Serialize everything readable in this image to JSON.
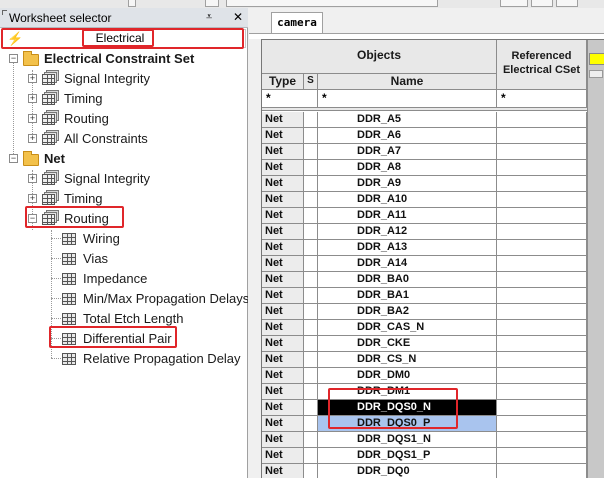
{
  "worksheet_selector": {
    "title": "Worksheet selector",
    "pin_glyph": "⩡",
    "close_glyph": "✕",
    "domain_value": "Electrical",
    "tree": [
      {
        "label": "Electrical Constraint Set",
        "icon": "folder-open-icon"
      },
      {
        "label": "Signal Integrity",
        "icon": "worksheet-stack-icon"
      },
      {
        "label": "Timing",
        "icon": "worksheet-stack-icon"
      },
      {
        "label": "Routing",
        "icon": "worksheet-stack-icon"
      },
      {
        "label": "All Constraints",
        "icon": "worksheet-stack-icon"
      },
      {
        "label": "Net",
        "icon": "folder-open-icon"
      },
      {
        "label": "Signal Integrity",
        "icon": "worksheet-stack-icon"
      },
      {
        "label": "Timing",
        "icon": "worksheet-stack-icon"
      },
      {
        "label": "Routing",
        "icon": "worksheet-stack-icon"
      },
      {
        "label": "Wiring",
        "icon": "worksheet-icon"
      },
      {
        "label": "Vias",
        "icon": "worksheet-icon"
      },
      {
        "label": "Impedance",
        "icon": "worksheet-icon"
      },
      {
        "label": "Min/Max Propagation Delays",
        "icon": "worksheet-icon"
      },
      {
        "label": "Total Etch Length",
        "icon": "worksheet-icon"
      },
      {
        "label": "Differential Pair",
        "icon": "worksheet-icon"
      },
      {
        "label": "Relative Propagation Delay",
        "icon": "worksheet-icon"
      }
    ]
  },
  "spreadsheet": {
    "tab_label": "camera",
    "headers": {
      "objects": "Objects",
      "referenced": "Referenced Electrical CSet",
      "type": "Type",
      "s": "S",
      "name": "Name"
    },
    "filter_values": {
      "type": "*",
      "name": "*",
      "ref": "*"
    },
    "rows": [
      {
        "type": "Net",
        "name": "DDR_A5"
      },
      {
        "type": "Net",
        "name": "DDR_A6"
      },
      {
        "type": "Net",
        "name": "DDR_A7"
      },
      {
        "type": "Net",
        "name": "DDR_A8"
      },
      {
        "type": "Net",
        "name": "DDR_A9"
      },
      {
        "type": "Net",
        "name": "DDR_A10"
      },
      {
        "type": "Net",
        "name": "DDR_A11"
      },
      {
        "type": "Net",
        "name": "DDR_A12"
      },
      {
        "type": "Net",
        "name": "DDR_A13"
      },
      {
        "type": "Net",
        "name": "DDR_A14"
      },
      {
        "type": "Net",
        "name": "DDR_BA0"
      },
      {
        "type": "Net",
        "name": "DDR_BA1"
      },
      {
        "type": "Net",
        "name": "DDR_BA2"
      },
      {
        "type": "Net",
        "name": "DDR_CAS_N"
      },
      {
        "type": "Net",
        "name": "DDR_CKE"
      },
      {
        "type": "Net",
        "name": "DDR_CS_N"
      },
      {
        "type": "Net",
        "name": "DDR_DM0"
      },
      {
        "type": "Net",
        "name": "DDR_DM1"
      },
      {
        "type": "Net",
        "name": "DDR_DQS0_N",
        "state": "selected-focus"
      },
      {
        "type": "Net",
        "name": "DDR_DQS0_P",
        "state": "selected"
      },
      {
        "type": "Net",
        "name": "DDR_DQS1_N"
      },
      {
        "type": "Net",
        "name": "DDR_DQS1_P"
      },
      {
        "type": "Net",
        "name": "DDR_DQ0"
      }
    ]
  },
  "colors": {
    "highlight_box": "#e0262a",
    "row_focus_bg": "#000000",
    "row_selected_bg": "#a9c4ee",
    "column_marker": "#ffff00"
  }
}
